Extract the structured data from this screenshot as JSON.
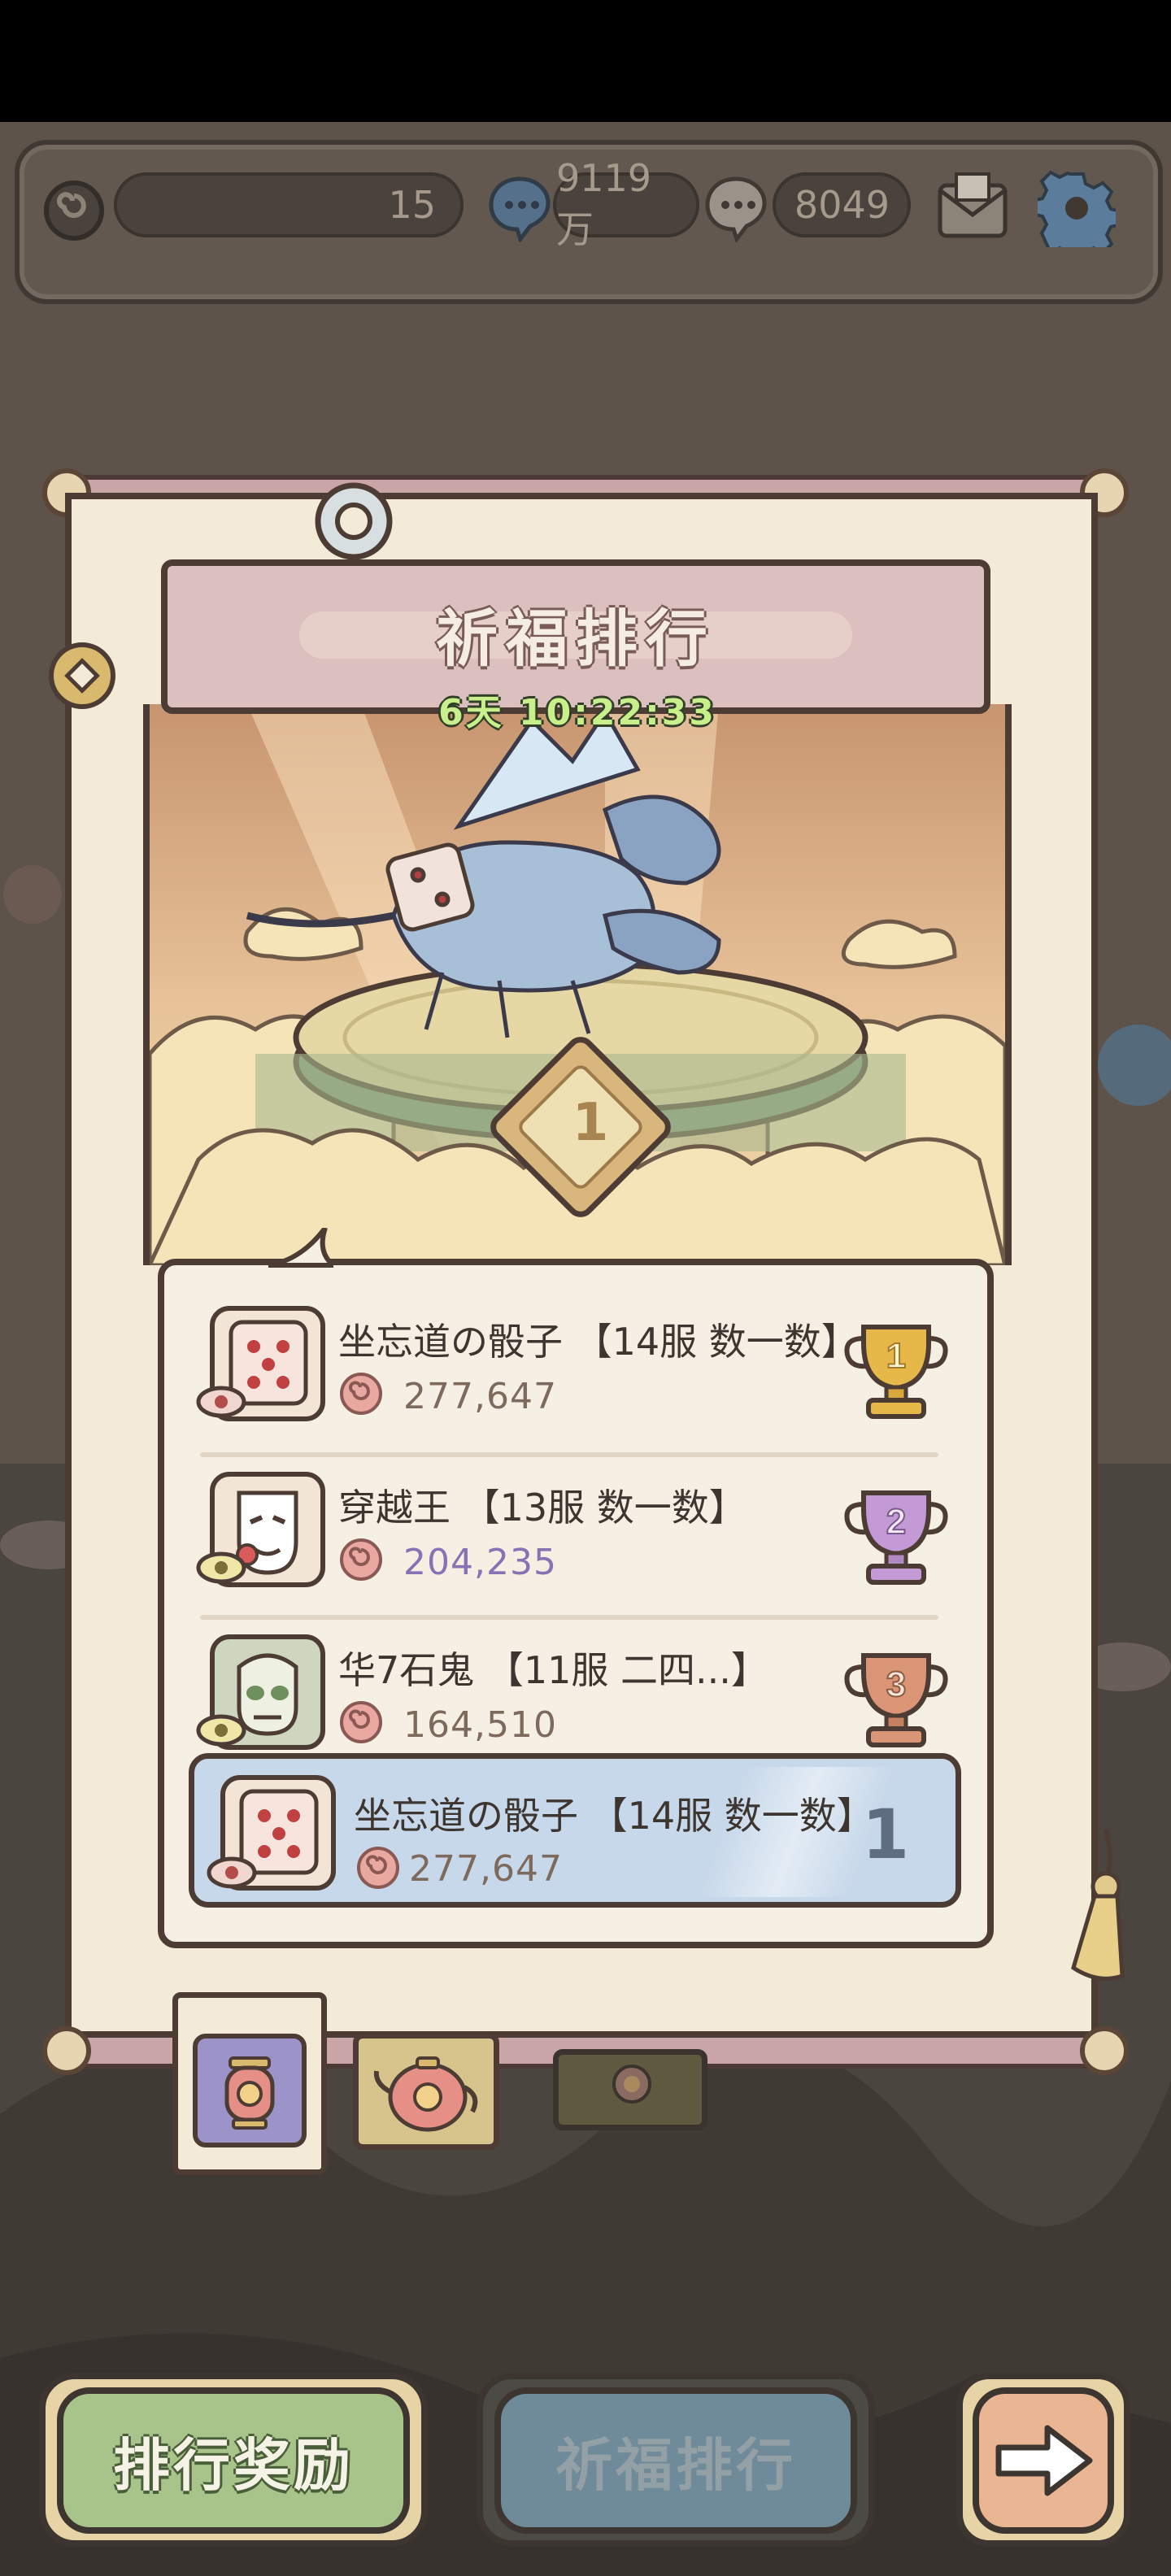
{
  "hud": {
    "level_value": "15",
    "currency_1_value": "9119万",
    "currency_2_value": "8049",
    "icons": [
      "swirl-icon",
      "chat-bubble-blue-icon",
      "chat-bubble-white-icon",
      "mail-icon",
      "gear-icon"
    ]
  },
  "banner": {
    "title": "祈福排行",
    "timer": "6天 10:22:33"
  },
  "podium": {
    "rank_badge": "1"
  },
  "ranking": {
    "rows": [
      {
        "rank": "1",
        "name": "坐忘道の骰子 【14服 数一数】",
        "score": "277,647",
        "avatar": "dice",
        "trophy_color": "#d9a83c"
      },
      {
        "rank": "2",
        "name": "穿越王 【13服 数一数】",
        "score": "204,235",
        "avatar": "mask",
        "trophy_color": "#c39ad6"
      },
      {
        "rank": "3",
        "name": "华7石鬼 【11服 二四...】",
        "score": "164,510",
        "avatar": "skull",
        "trophy_color": "#d99576"
      }
    ],
    "self_row": {
      "rank": "1",
      "name": "坐忘道の骰子 【14服 数一数】",
      "score": "277,647"
    }
  },
  "tabs": [
    "lantern-tab",
    "teapot-tab",
    "flower-tab"
  ],
  "buttons": {
    "rewards_label": "排行奖励",
    "ranking_label": "祈福排行",
    "next_icon": "arrow-right-icon"
  },
  "colors": {
    "self_row_bg": "#c7d8ea",
    "rank2_score": "#8872b4",
    "rewards_btn": "#a8c48a",
    "ranking_btn": "#6f8a98",
    "next_btn": "#e9b593"
  }
}
